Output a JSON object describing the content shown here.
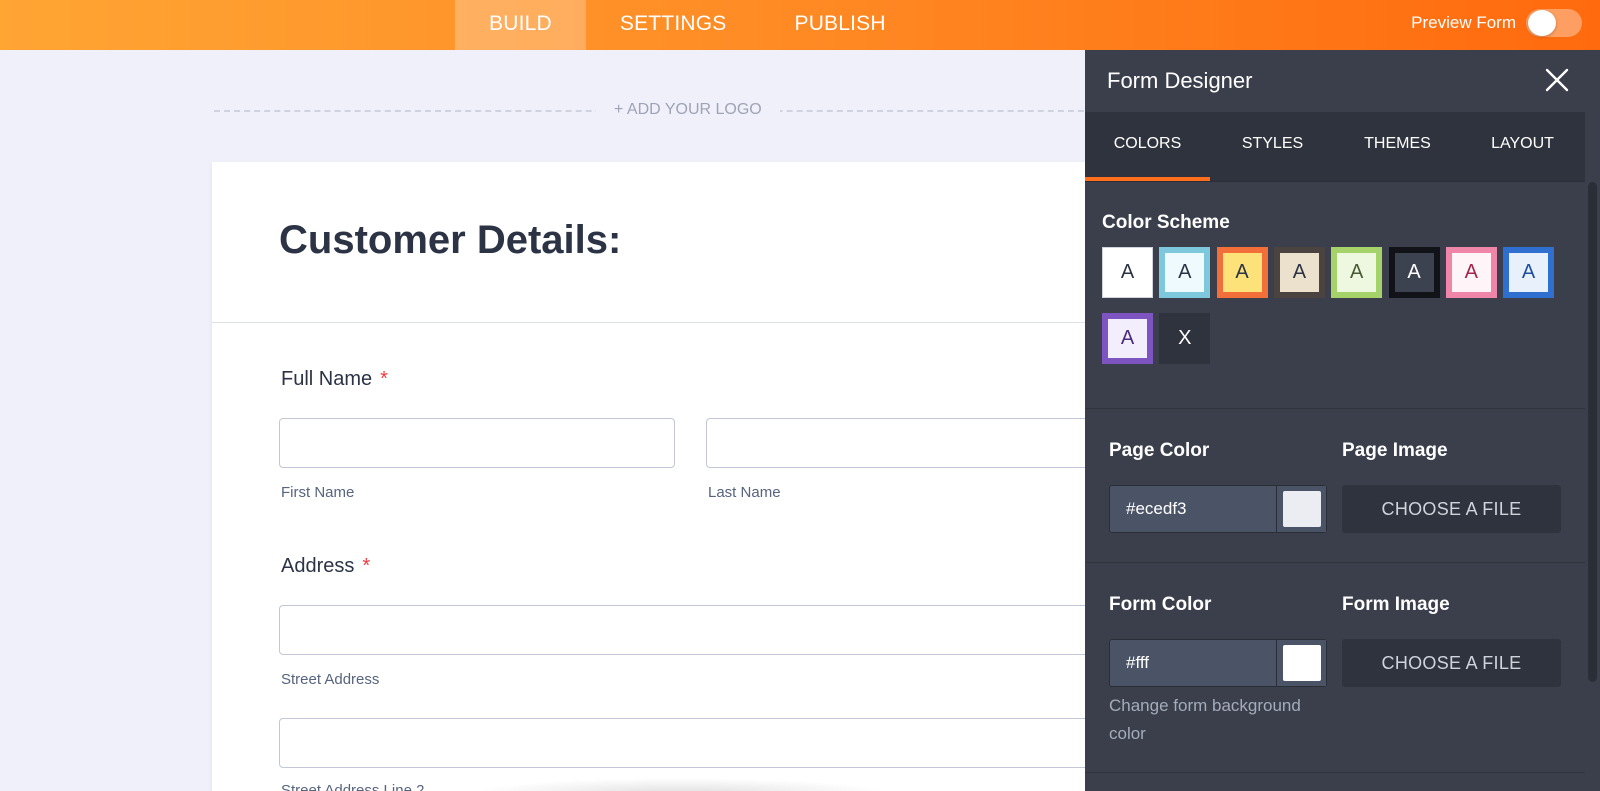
{
  "topbar": {
    "tabs": [
      {
        "label": "BUILD",
        "active": true
      },
      {
        "label": "SETTINGS",
        "active": false
      },
      {
        "label": "PUBLISH",
        "active": false
      }
    ],
    "preview_label": "Preview Form",
    "preview_on": false
  },
  "logo": {
    "label": "+ ADD YOUR LOGO"
  },
  "form": {
    "title": "Customer Details:",
    "full_name": {
      "label": "Full Name",
      "required": "*",
      "first_sublabel": "First Name",
      "last_sublabel": "Last Name"
    },
    "address": {
      "label": "Address",
      "required": "*",
      "street_sublabel": "Street Address",
      "street2_sublabel": "Street Address Line 2"
    }
  },
  "designer": {
    "title": "Form Designer",
    "close_icon": "close-icon",
    "tabs": [
      {
        "label": "COLORS",
        "active": true
      },
      {
        "label": "STYLES",
        "active": false
      },
      {
        "label": "THEMES",
        "active": false
      },
      {
        "label": "LAYOUT",
        "active": false
      }
    ],
    "color_scheme": {
      "title": "Color Scheme",
      "swatches": [
        {
          "label": "A",
          "border": "#ffffff",
          "fill": "#ffffff",
          "text": "#2c3345"
        },
        {
          "label": "A",
          "border": "#7dc8dc",
          "fill": "#eefafd",
          "text": "#2c3345"
        },
        {
          "label": "A",
          "border": "#f26f3a",
          "fill": "#fde27a",
          "text": "#2c3345"
        },
        {
          "label": "A",
          "border": "#4a4340",
          "fill": "#ebe1cd",
          "text": "#2c3345"
        },
        {
          "label": "A",
          "border": "#a5d36a",
          "fill": "#eef7df",
          "text": "#4a5a34"
        },
        {
          "label": "A",
          "border": "#111318",
          "fill": "#3d4251",
          "text": "#ffffff"
        },
        {
          "label": "A",
          "border": "#ef86a9",
          "fill": "#fff4f7",
          "text": "#a3254d"
        },
        {
          "label": "A",
          "border": "#2e6fd0",
          "fill": "#e8f1fb",
          "text": "#1f4f9a"
        },
        {
          "label": "A",
          "border": "#7d54c0",
          "fill": "#f3eefc",
          "text": "#4b2b80"
        },
        {
          "label": "X",
          "border": "#2f333d",
          "fill": "#2f333d",
          "text": "#ffffff"
        }
      ]
    },
    "page_color": {
      "title": "Page Color",
      "value": "#ecedf3",
      "swatch": "#ecedf3"
    },
    "page_image": {
      "title": "Page Image",
      "button": "CHOOSE A FILE"
    },
    "form_color": {
      "title": "Form Color",
      "value": "#fff",
      "swatch": "#ffffff",
      "help": "Change form background color"
    },
    "form_image": {
      "title": "Form Image",
      "button": "CHOOSE A FILE"
    }
  }
}
